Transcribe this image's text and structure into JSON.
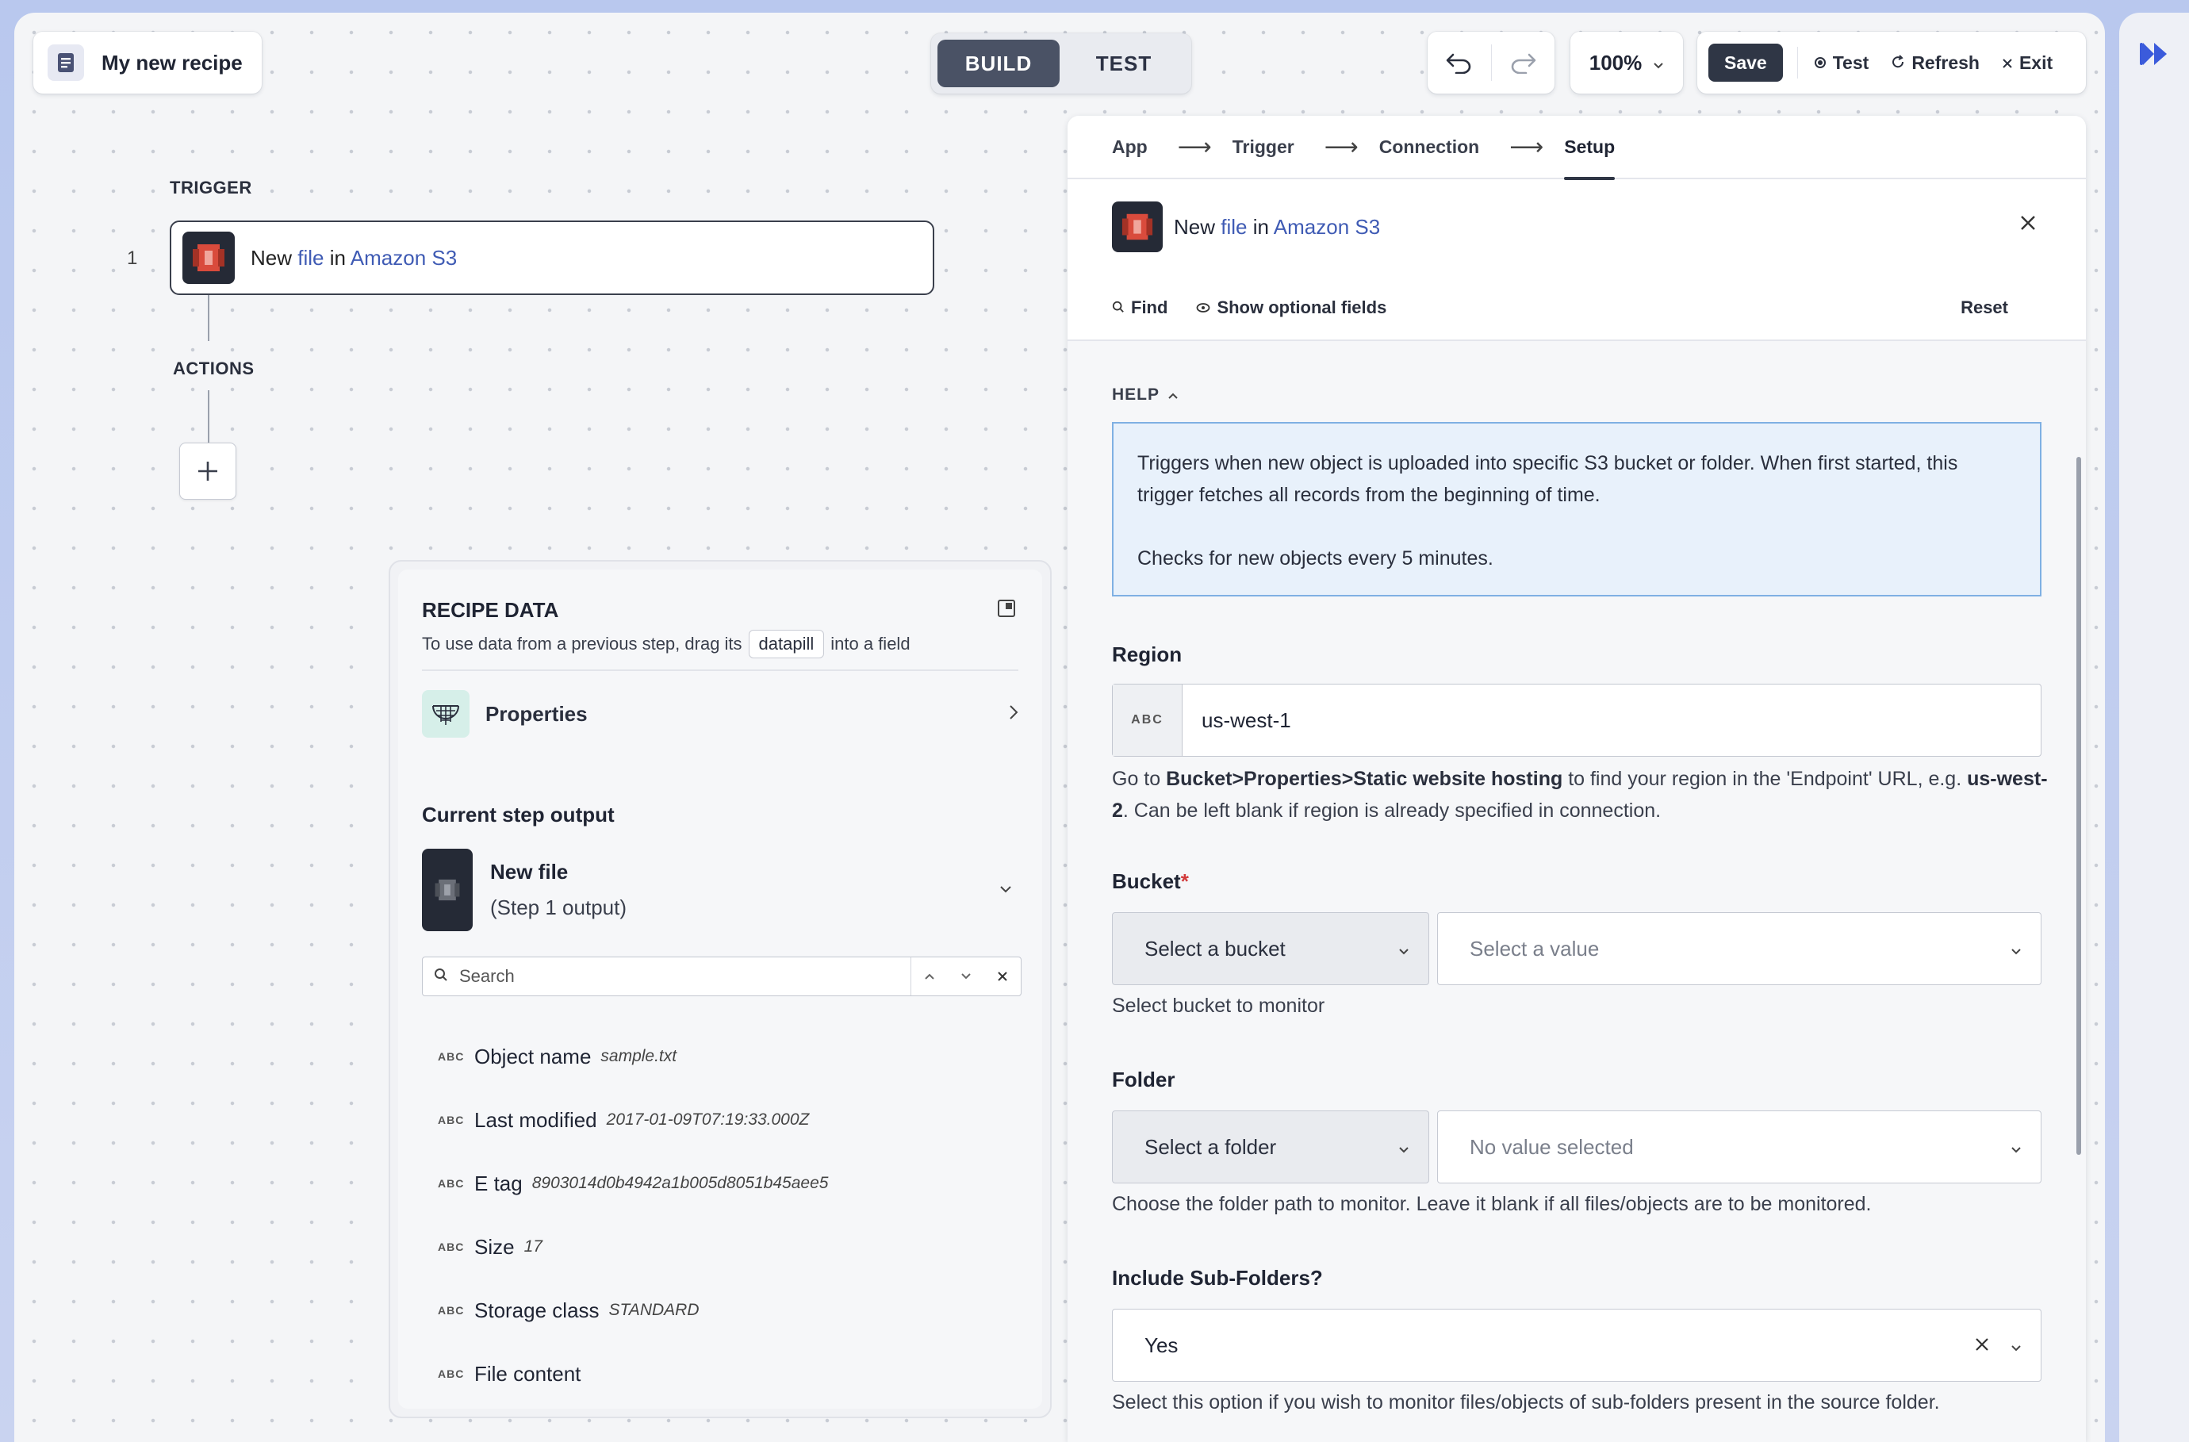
{
  "header": {
    "recipe_title": "My new recipe",
    "mode_build": "BUILD",
    "mode_test": "TEST",
    "zoom": "100%",
    "save": "Save",
    "test": "Test",
    "refresh": "Refresh",
    "exit": "Exit"
  },
  "flow": {
    "trigger_label": "TRIGGER",
    "actions_label": "ACTIONS",
    "step_number": "1",
    "step": {
      "prefix": "New",
      "object": "file",
      "in": "in",
      "app": "Amazon S3"
    }
  },
  "recipe_data": {
    "title": "RECIPE DATA",
    "sub_before": "To use data from a previous step, drag its",
    "pill": "datapill",
    "sub_after": "into a field",
    "properties": "Properties",
    "current_output": "Current step output",
    "new_file": "New file",
    "step_output": "(Step 1 output)",
    "search_placeholder": "Search",
    "type_badge": "ABC",
    "fields": [
      {
        "name": "Object name",
        "sample": "sample.txt"
      },
      {
        "name": "Last modified",
        "sample": "2017-01-09T07:19:33.000Z"
      },
      {
        "name": "E tag",
        "sample": "8903014d0b4942a1b005d8051b45aee5"
      },
      {
        "name": "Size",
        "sample": "17"
      },
      {
        "name": "Storage class",
        "sample": "STANDARD"
      },
      {
        "name": "File content",
        "sample": ""
      }
    ]
  },
  "panel": {
    "nav": [
      "App",
      "Trigger",
      "Connection",
      "Setup"
    ],
    "header": {
      "prefix": "New",
      "object": "file",
      "in": "in",
      "app": "Amazon S3"
    },
    "find": "Find",
    "show_optional": "Show optional fields",
    "reset": "Reset",
    "help_label": "HELP",
    "help_p1": "Triggers when new object is uploaded into specific S3 bucket or folder. When first started, this trigger fetches all records from the beginning of time.",
    "help_p2": "Checks for new objects every 5 minutes.",
    "region": {
      "label": "Region",
      "type": "ABC",
      "value": "us-west-1",
      "hint_1": "Go to ",
      "hint_bold_1": "Bucket>Properties>Static website hosting",
      "hint_2": " to find your region in the 'Endpoint' URL, e.g. ",
      "hint_bold_2": "us-west-2",
      "hint_3": ". Can be left blank if region is already specified in connection."
    },
    "bucket": {
      "label": "Bucket",
      "required": "*",
      "mode": "Select a bucket",
      "value_placeholder": "Select a value",
      "hint": "Select bucket to monitor"
    },
    "folder": {
      "label": "Folder",
      "mode": "Select a folder",
      "value_placeholder": "No value selected",
      "hint": "Choose the folder path to monitor. Leave it blank if all files/objects are to be monitored."
    },
    "subfolders": {
      "label": "Include Sub-Folders?",
      "value": "Yes",
      "hint": "Select this option if you wish to monitor files/objects of sub-folders present in the source folder."
    }
  },
  "colors": {
    "accent_link": "#3f5bb4",
    "dark_button": "#2f3645",
    "help_bg": "#e8f1fb",
    "help_border": "#7fb0e3",
    "required": "#d23a3a"
  }
}
